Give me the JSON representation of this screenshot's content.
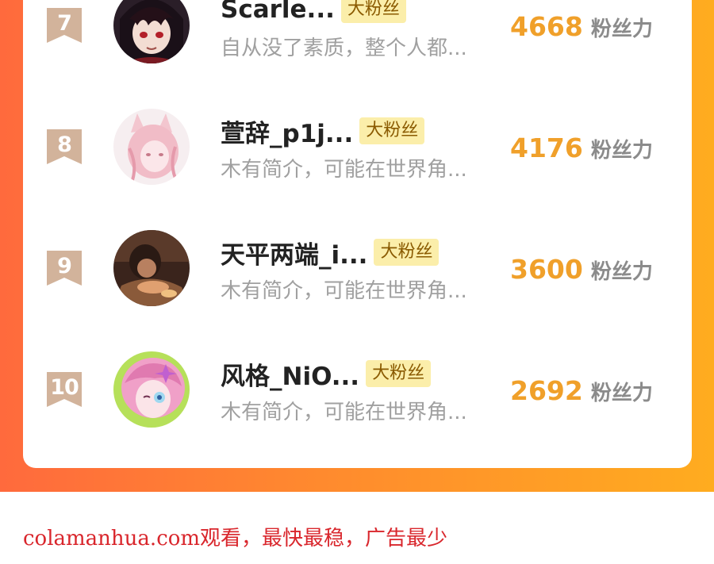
{
  "leaderboard": {
    "rows": [
      {
        "rank": "7",
        "name": "Scarle...",
        "badge": "大粉丝",
        "bio": "自从没了素质，整个人都...",
        "fans": "4668",
        "fans_unit": "粉丝力"
      },
      {
        "rank": "8",
        "name": "萱辞_p1j...",
        "badge": "大粉丝",
        "bio": "木有简介，可能在世界角...",
        "fans": "4176",
        "fans_unit": "粉丝力"
      },
      {
        "rank": "9",
        "name": "天平两端_i...",
        "badge": "大粉丝",
        "bio": "木有简介，可能在世界角...",
        "fans": "3600",
        "fans_unit": "粉丝力"
      },
      {
        "rank": "10",
        "name": "风格_NiO...",
        "badge": "大粉丝",
        "bio": "木有简介，可能在世界角...",
        "fans": "2692",
        "fans_unit": "粉丝力"
      }
    ]
  },
  "footer": {
    "text": "colamanhua.com观看，最快最稳，广告最少"
  },
  "colors": {
    "banner_start": "#ff6a3d",
    "banner_end": "#ffac1f",
    "fans_value": "#f0a02a",
    "badge_bg": "#fbeeaa",
    "rank_ribbon": "#d2b39b",
    "footer_text": "#d9262c"
  },
  "avatars": [
    "dark-haired-character-avatar",
    "pink-cat-girl-avatar",
    "photo-avatar",
    "pink-anime-avatar"
  ]
}
